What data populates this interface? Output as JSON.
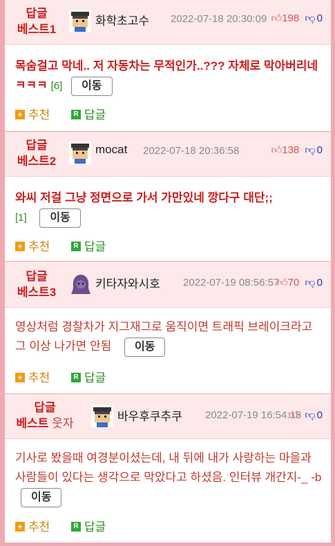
{
  "replies": [
    {
      "badge_line1": "답글",
      "badge_line2": "베스트1",
      "badge_extra": "",
      "avatar_icon": "gamer-avatar-icon",
      "nick": "화학초고수",
      "date": "2022-07-18 20:30:09",
      "up": "198",
      "down": "0",
      "text": "목숨걸고 막네.. 저 자동차는 무적인가..??? 자체로 막아버리네 ㅋㅋㅋ",
      "count": "[6]",
      "move": "이동",
      "recommend": "추천",
      "reply": "답글"
    },
    {
      "badge_line1": "답글",
      "badge_line2": "베스트2",
      "badge_extra": "",
      "avatar_icon": "gamer-avatar-icon",
      "nick": "mocat",
      "date": "2022-07-18 20:36:58",
      "up": "138",
      "down": "0",
      "text": "와씨 저걸 그냥 정면으로 가서 가만있네 깡다구 대단;;",
      "count": "[1]",
      "move": "이동",
      "recommend": "추천",
      "reply": "답글"
    },
    {
      "badge_line1": "답글",
      "badge_line2": "베스트3",
      "badge_extra": "",
      "avatar_icon": "purple-character-avatar-icon",
      "nick": "키타자와시호",
      "date": "2022-07-19 08:56:57",
      "up": "70",
      "down": "0",
      "text": "영상처럼 경찰차가 지그재그로 움직이면 트래픽 브레이크라고 그 이상 나가면 안됨",
      "count": "",
      "move": "이동",
      "recommend": "추천",
      "reply": "답글"
    },
    {
      "badge_line1": "답글",
      "badge_line2": "베스트",
      "badge_extra": "웃자",
      "avatar_icon": "gamer-avatar-icon",
      "nick": "바우후쿠추쿠",
      "date": "2022-07-19 16:54:18",
      "up": "",
      "down": "0",
      "text": "기사로 봤을때 여경분이셨는데, 내 뒤에 내가 사랑하는 마을과 사람들이 있다는 생각으로 막았다고 하셨음. 인터뷰 개간지-_ -b",
      "count": "",
      "move": "이동",
      "recommend": "추천",
      "reply": "답글"
    }
  ]
}
